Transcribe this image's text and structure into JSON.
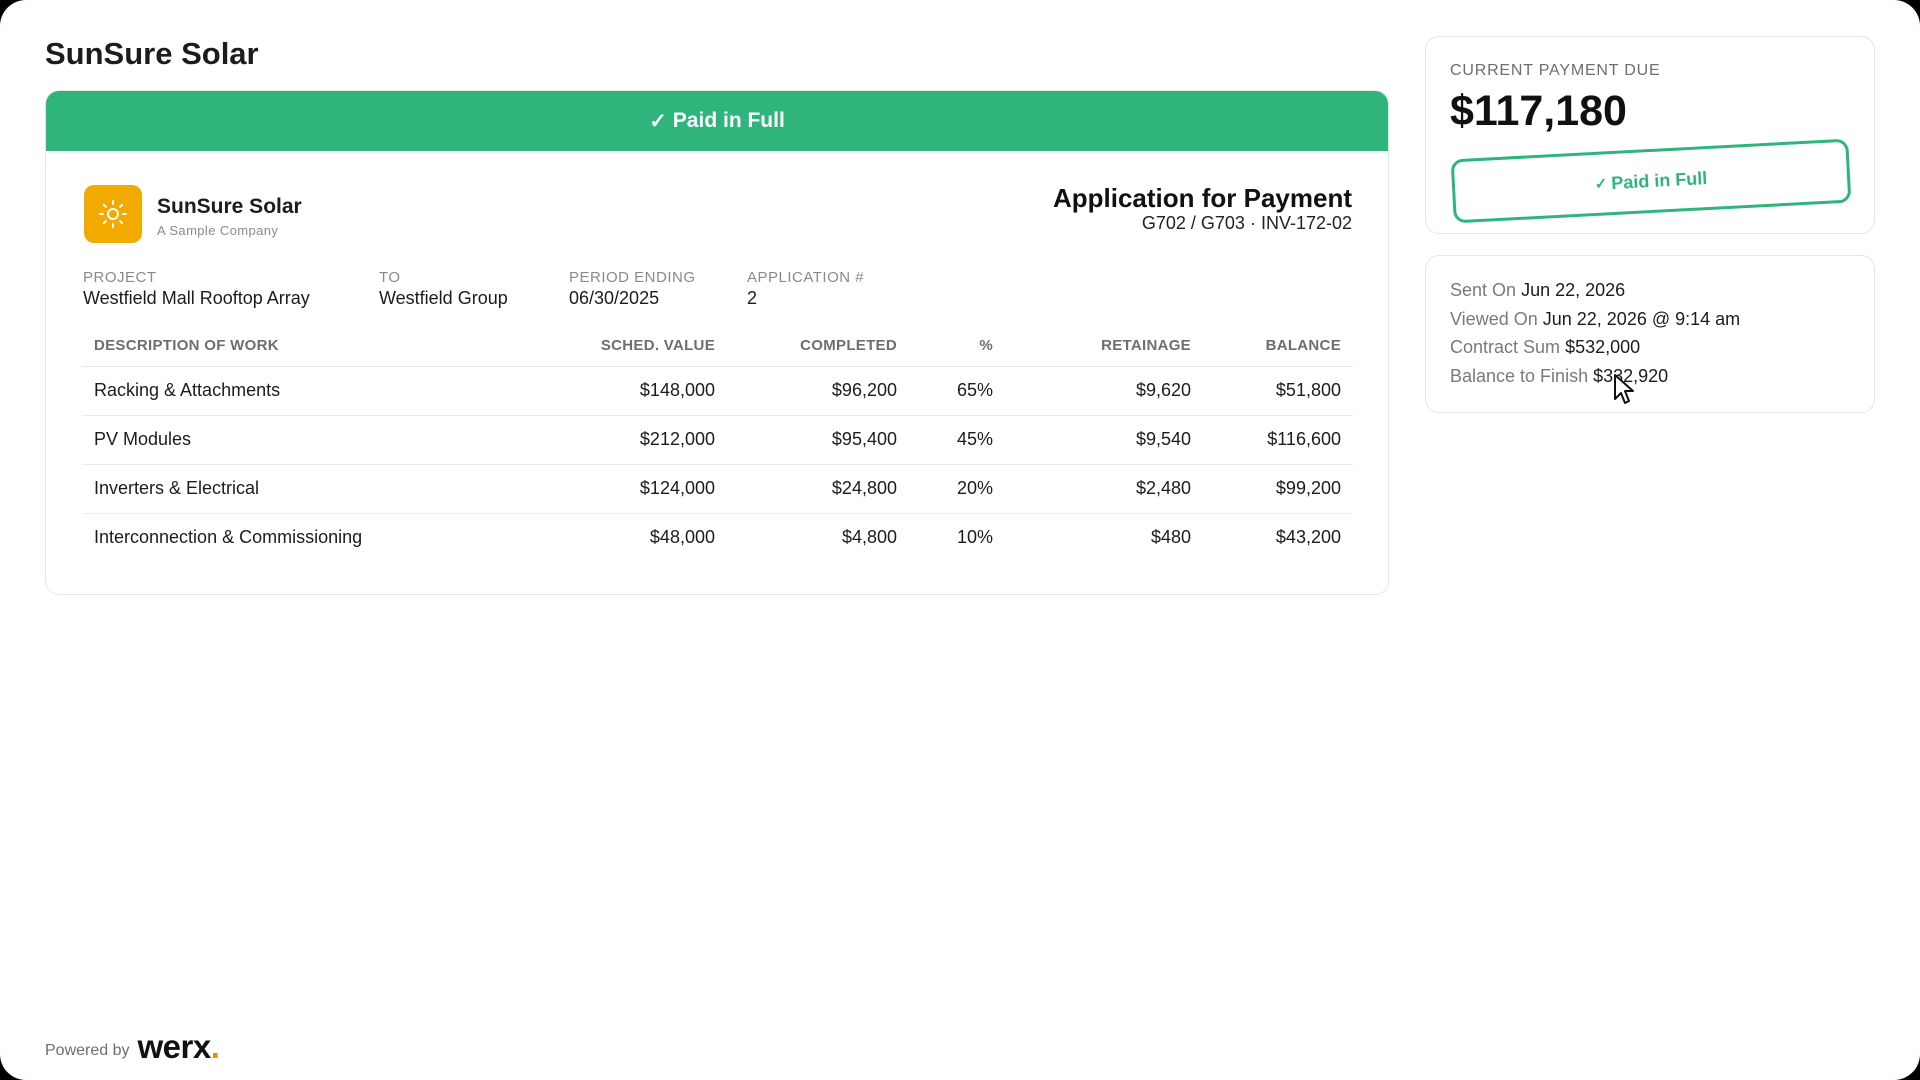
{
  "page": {
    "title": "SunSure Solar"
  },
  "banner": {
    "check": "✓",
    "label": "Paid in Full"
  },
  "invoice": {
    "company_name": "SunSure Solar",
    "company_sub": "A Sample Company",
    "doc_title": "Application for Payment",
    "doc_sub": "G702 / G703 · INV-172-02",
    "meta": {
      "project_label": "PROJECT",
      "project_value": "Westfield Mall Rooftop Array",
      "to_label": "TO",
      "to_value": "Westfield Group",
      "period_label": "PERIOD ENDING",
      "period_value": "06/30/2025",
      "app_label": "APPLICATION #",
      "app_value": "2"
    },
    "table": {
      "headers": {
        "description": "DESCRIPTION OF WORK",
        "sched_value": "SCHED. VALUE",
        "completed": "COMPLETED",
        "percent": "%",
        "retainage": "RETAINAGE",
        "balance": "BALANCE"
      },
      "rows": [
        {
          "description": "Racking & Attachments",
          "sched_value": "$148,000",
          "completed": "$96,200",
          "percent": "65%",
          "retainage": "$9,620",
          "balance": "$51,800"
        },
        {
          "description": "PV Modules",
          "sched_value": "$212,000",
          "completed": "$95,400",
          "percent": "45%",
          "retainage": "$9,540",
          "balance": "$116,600"
        },
        {
          "description": "Inverters & Electrical",
          "sched_value": "$124,000",
          "completed": "$24,800",
          "percent": "20%",
          "retainage": "$2,480",
          "balance": "$99,200"
        },
        {
          "description": "Interconnection & Commissioning",
          "sched_value": "$48,000",
          "completed": "$4,800",
          "percent": "10%",
          "retainage": "$480",
          "balance": "$43,200"
        }
      ]
    }
  },
  "payment": {
    "label": "CURRENT PAYMENT DUE",
    "amount": "$117,180",
    "stamp_check": "✓",
    "stamp_label": "Paid in Full"
  },
  "details": {
    "sent_label": "Sent On",
    "sent_value": "Jun 22, 2026",
    "viewed_label": "Viewed On",
    "viewed_value": "Jun 22, 2026 @ 9:14 am",
    "contract_label": "Contract Sum",
    "contract_value": "$532,000",
    "balance_label": "Balance to Finish",
    "balance_value": "$332,920"
  },
  "footer": {
    "powered_by": "Powered by",
    "brand": "werx",
    "brand_dot": "."
  },
  "colors": {
    "accent": "#2fb57c",
    "logo_bg": "#f2a900",
    "brand_dot": "#f28c00"
  },
  "icons": {
    "logo": "sun-icon",
    "check": "check-icon",
    "cursor": "mouse-pointer-icon"
  }
}
